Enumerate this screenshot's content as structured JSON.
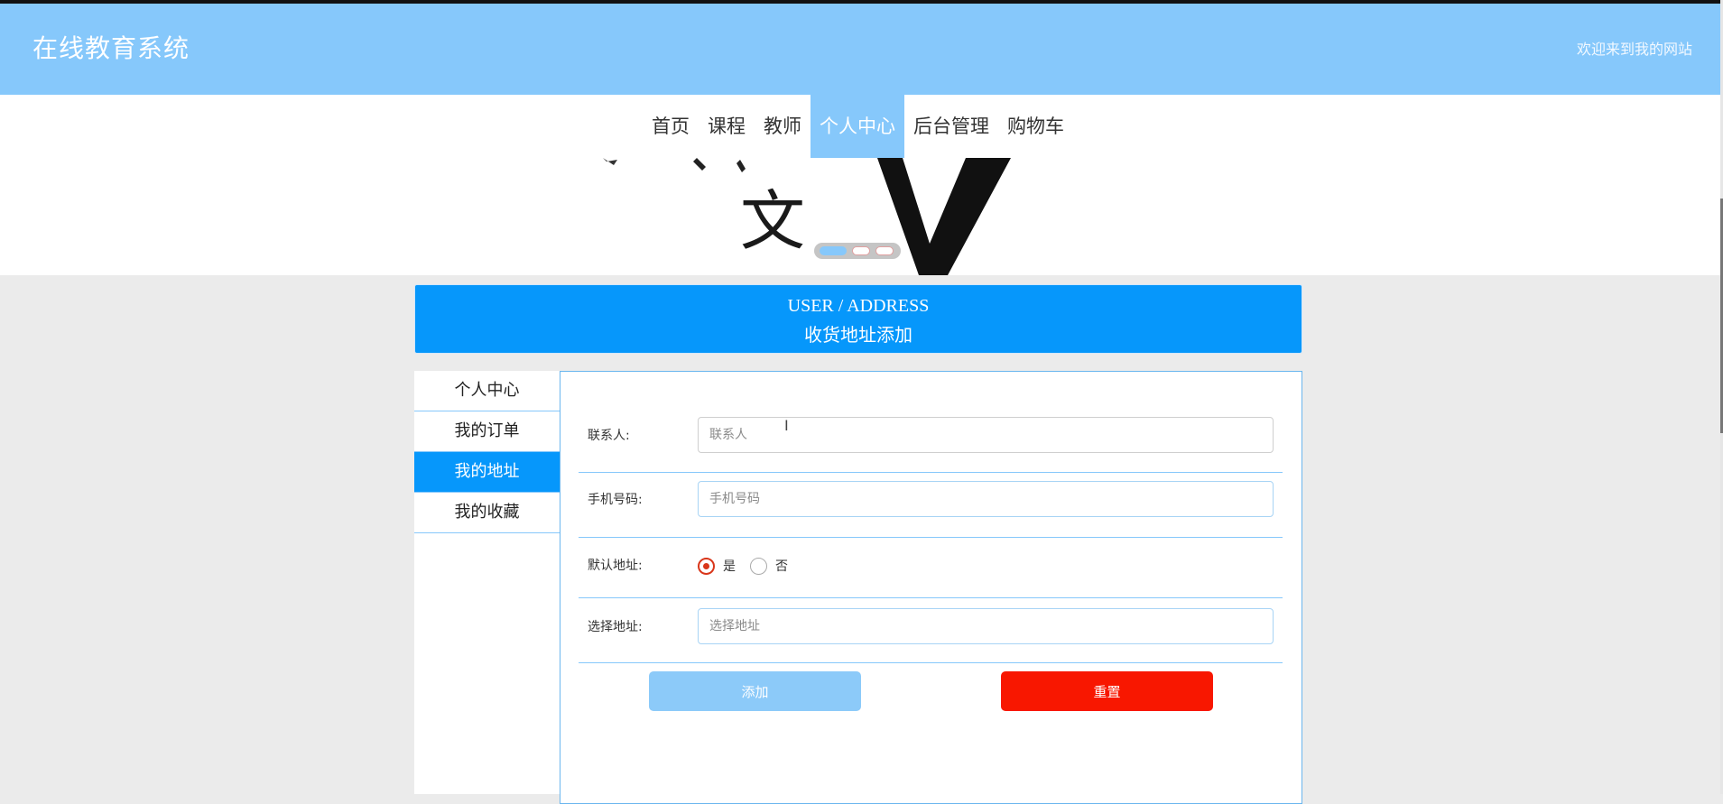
{
  "header": {
    "site_title": "在线教育系统",
    "welcome": "欢迎来到我的网站"
  },
  "nav": {
    "items": [
      {
        "label": "首页",
        "active": false
      },
      {
        "label": "课程",
        "active": false
      },
      {
        "label": "教师",
        "active": false
      },
      {
        "label": "个人中心",
        "active": true
      },
      {
        "label": "后台管理",
        "active": false
      },
      {
        "label": "购物车",
        "active": false
      }
    ]
  },
  "banner": {
    "image_text": "文"
  },
  "title_box": {
    "en": "USER / ADDRESS",
    "cn": "收货地址添加"
  },
  "sidebar": {
    "items": [
      {
        "label": "个人中心",
        "active": false
      },
      {
        "label": "我的订单",
        "active": false
      },
      {
        "label": "我的地址",
        "active": true
      },
      {
        "label": "我的收藏",
        "active": false
      }
    ]
  },
  "form": {
    "contact": {
      "label": "联系人:",
      "placeholder": "联系人",
      "value": ""
    },
    "phone": {
      "label": "手机号码:",
      "placeholder": "手机号码",
      "value": ""
    },
    "default_address": {
      "label": "默认地址:",
      "options": [
        {
          "label": "是",
          "checked": true
        },
        {
          "label": "否",
          "checked": false
        }
      ]
    },
    "address": {
      "label": "选择地址:",
      "placeholder": "选择地址",
      "value": ""
    },
    "add_button": "添加",
    "reset_button": "重置"
  },
  "colors": {
    "header_bg": "#86c8fb",
    "primary": "#0697fb",
    "danger": "#f81700",
    "radio_checked": "#d9361a"
  }
}
